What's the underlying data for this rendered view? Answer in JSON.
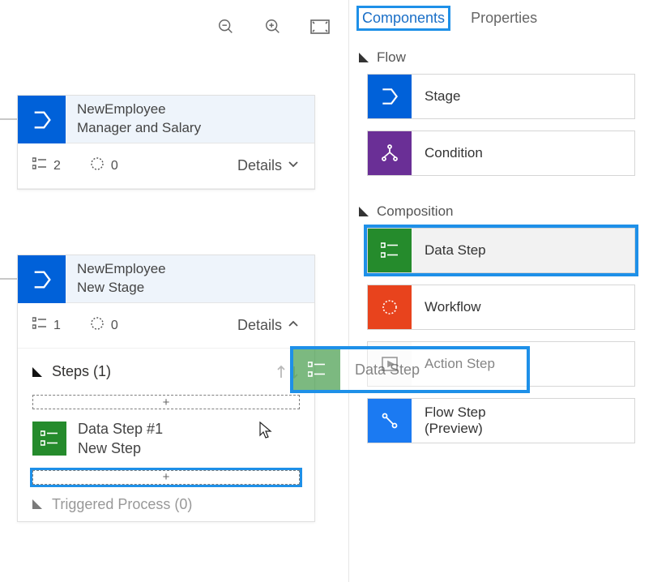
{
  "canvas": {
    "stage1": {
      "entity": "NewEmployee",
      "name": "Manager and Salary",
      "steps_count": "2",
      "workflow_count": "0",
      "details_label": "Details"
    },
    "stage2": {
      "entity": "NewEmployee",
      "name": "New Stage",
      "steps_count": "1",
      "workflow_count": "0",
      "details_label": "Details",
      "steps_header": "Steps (1)",
      "step1_title": "Data Step #1",
      "step1_sub": "New Step",
      "add_placeholder": "+",
      "triggered_label": "Triggered Process (0)"
    },
    "drag_ghost_label": "Data Step"
  },
  "tabs": {
    "components": "Components",
    "properties": "Properties"
  },
  "sections": {
    "flow": "Flow",
    "composition": "Composition"
  },
  "components": {
    "stage": "Stage",
    "condition": "Condition",
    "datastep": "Data Step",
    "workflow": "Workflow",
    "actionstep": "Action Step",
    "flowstep_line1": "Flow Step",
    "flowstep_line2": "(Preview)"
  }
}
